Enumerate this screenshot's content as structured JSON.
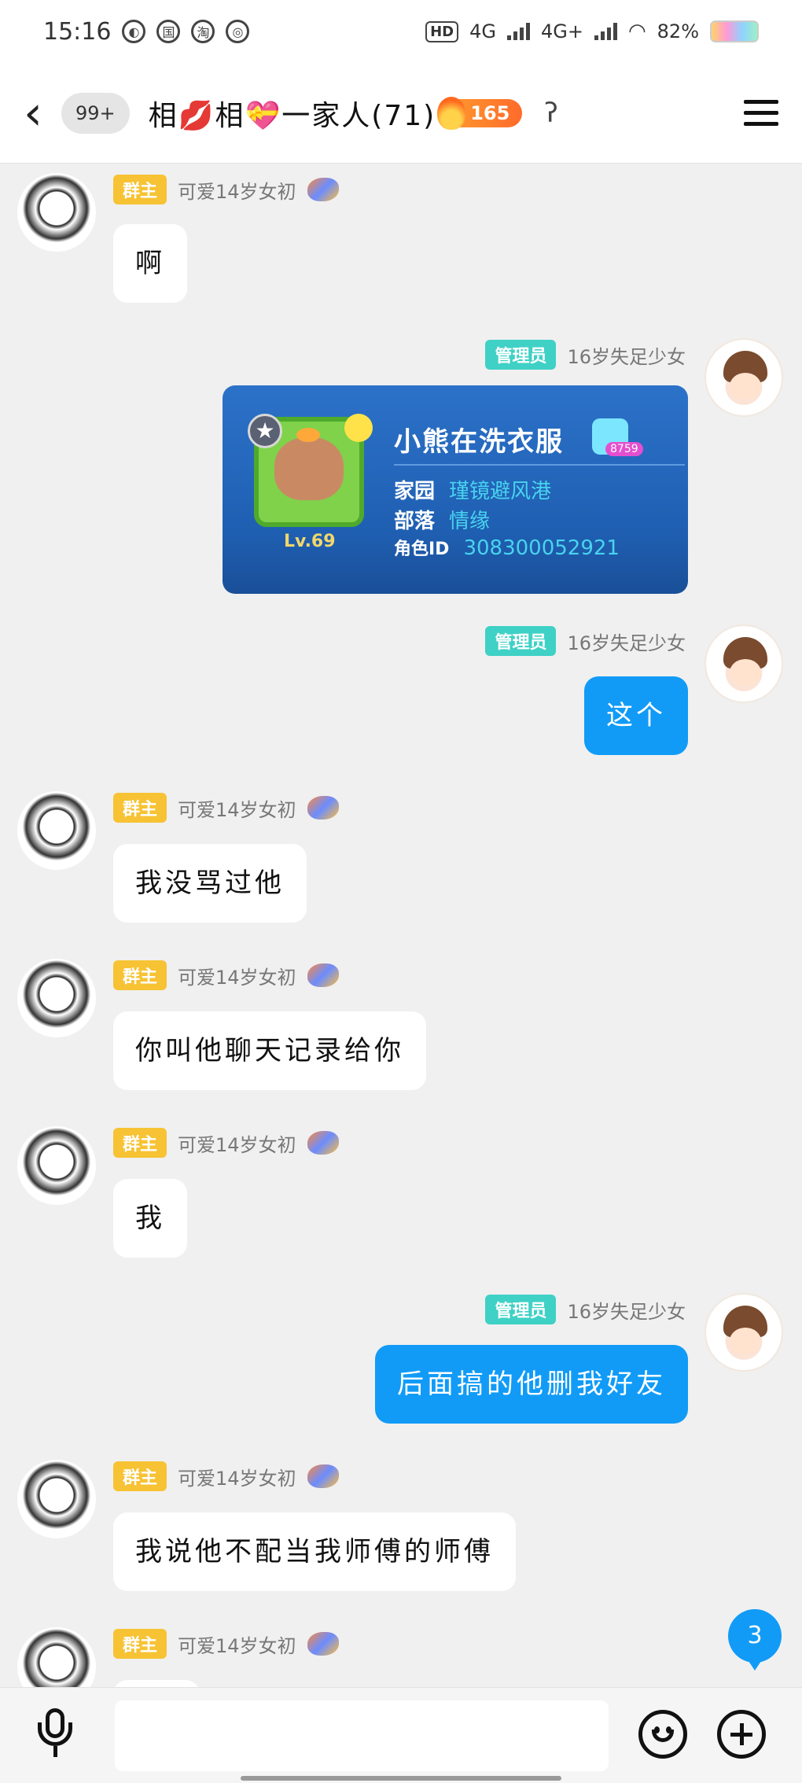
{
  "status_bar": {
    "time": "15:16",
    "network_hd": "HD",
    "network_1": "4G",
    "network_2": "4G+",
    "battery": "82%"
  },
  "header": {
    "back_label": "‹",
    "unread_count": "99+",
    "group_title": "相💋相💝一家人(71)",
    "fire_count": "165"
  },
  "senders": {
    "owner": {
      "role": "群主",
      "name": "可爱14岁女初"
    },
    "admin": {
      "role": "管理员",
      "name": "16岁失足少女"
    }
  },
  "messages": [
    {
      "from": "owner",
      "text": "啊"
    },
    {
      "from": "admin",
      "type": "image"
    },
    {
      "from": "admin",
      "text": "这个"
    },
    {
      "from": "owner",
      "text": "我没骂过他"
    },
    {
      "from": "owner",
      "text": "你叫他聊天记录给你"
    },
    {
      "from": "owner",
      "text": "我"
    },
    {
      "from": "admin",
      "text": "后面搞的他删我好友"
    },
    {
      "from": "owner",
      "text": "我说他不配当我师傅的师傅"
    },
    {
      "from": "owner",
      "text": ""
    }
  ],
  "card": {
    "name": "小熊在洗衣服",
    "badge_number": "8759",
    "level": "Lv.69",
    "home_label": "家园",
    "home_value": "瑾镜避风港",
    "tribe_label": "部落",
    "tribe_value": "情缘",
    "role_id_label": "角色ID",
    "role_id_value": "308300052921"
  },
  "unread_float": "3",
  "input": {
    "placeholder": ""
  }
}
